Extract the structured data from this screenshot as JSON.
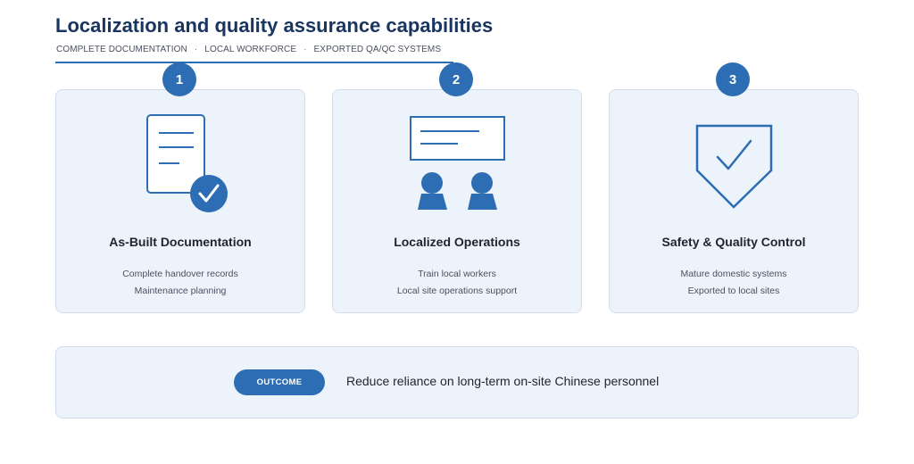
{
  "header": {
    "title": "Localization and quality assurance capabilities",
    "tags": [
      "COMPLETE DOCUMENTATION",
      "LOCAL WORKFORCE",
      "EXPORTED QA/QC SYSTEMS"
    ],
    "separator": "·"
  },
  "cards": [
    {
      "number": "1",
      "icon": "document-check-icon",
      "title": "As-Built Documentation",
      "lines": [
        "Complete handover records",
        "Maintenance planning"
      ]
    },
    {
      "number": "2",
      "icon": "team-training-icon",
      "title": "Localized Operations",
      "lines": [
        "Train local workers",
        "Local site operations support"
      ]
    },
    {
      "number": "3",
      "icon": "shield-check-icon",
      "title": "Safety & Quality Control",
      "lines": [
        "Mature domestic systems",
        "Exported to local sites"
      ]
    }
  ],
  "outcome": {
    "label": "OUTCOME",
    "text": "Reduce reliance on long-term on-site Chinese personnel"
  },
  "colors": {
    "accent": "#2d6db4",
    "title": "#1a3560",
    "card_bg": "#edf3fb",
    "card_border": "#d2ddec"
  }
}
